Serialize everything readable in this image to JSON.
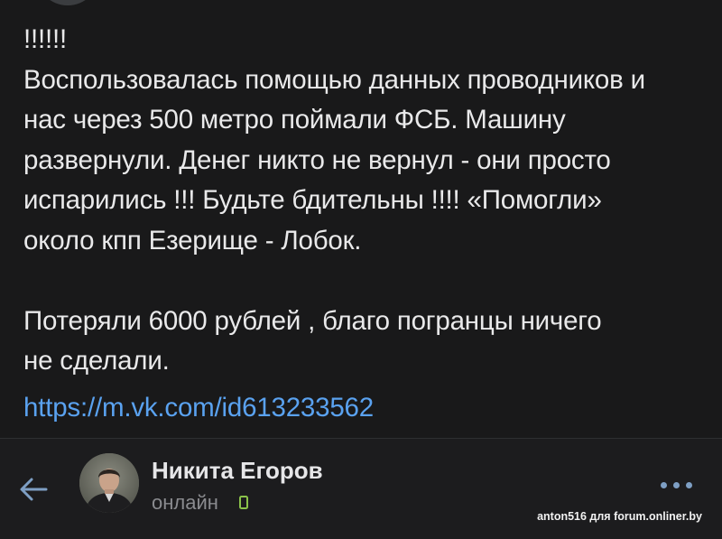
{
  "message": {
    "lines": [
      "!!!!!!",
      "Воспользовалась помощью данных проводников и",
      "нас через 500 метро поймали ФСБ. Машину",
      "развернули. Денег никто не вернул - они просто",
      "испарились !!! Будьте бдительны !!!!  «Помогли»",
      "около кпп Езерище - Лобок.",
      "Потеряли 6000 рублей , благо погранцы ничего",
      "не сделали."
    ],
    "link": "https://m.vk.com/id613233562"
  },
  "header": {
    "back_icon": "back-arrow-icon",
    "user_name": "Никита Егоров",
    "status": "онлайн",
    "status_icon": "mobile-online-icon",
    "more_icon": "more-dots-icon"
  },
  "watermark": "anton516 для forum.onliner.by",
  "colors": {
    "background": "#19191a",
    "text": "#e9e9ea",
    "link": "#5aa2f0",
    "online": "#8ac24a",
    "accent": "#7e9fc4"
  }
}
